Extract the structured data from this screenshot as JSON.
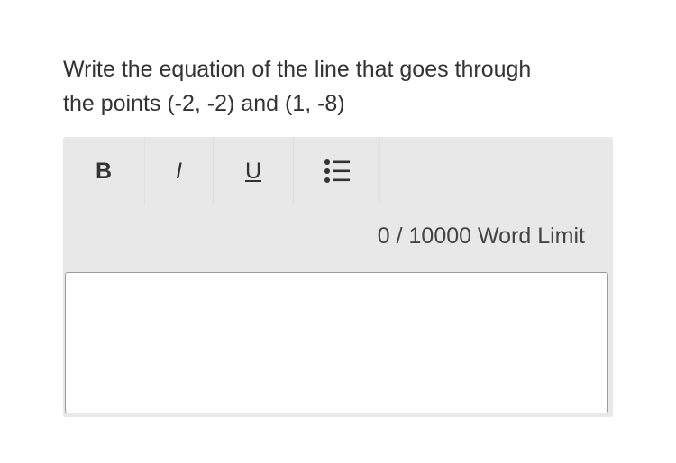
{
  "question": {
    "line1": "Write the equation of the line that goes through",
    "line2": "the points (-2, -2) and (1, -8)"
  },
  "toolbar": {
    "bold_label": "B",
    "italic_label": "I",
    "underline_label": "U",
    "list_icon": "bulleted-list-icon"
  },
  "word_counter": {
    "current": "0",
    "separator": " / ",
    "limit": "10000",
    "suffix": " Word Limit"
  },
  "answer": {
    "value": ""
  }
}
